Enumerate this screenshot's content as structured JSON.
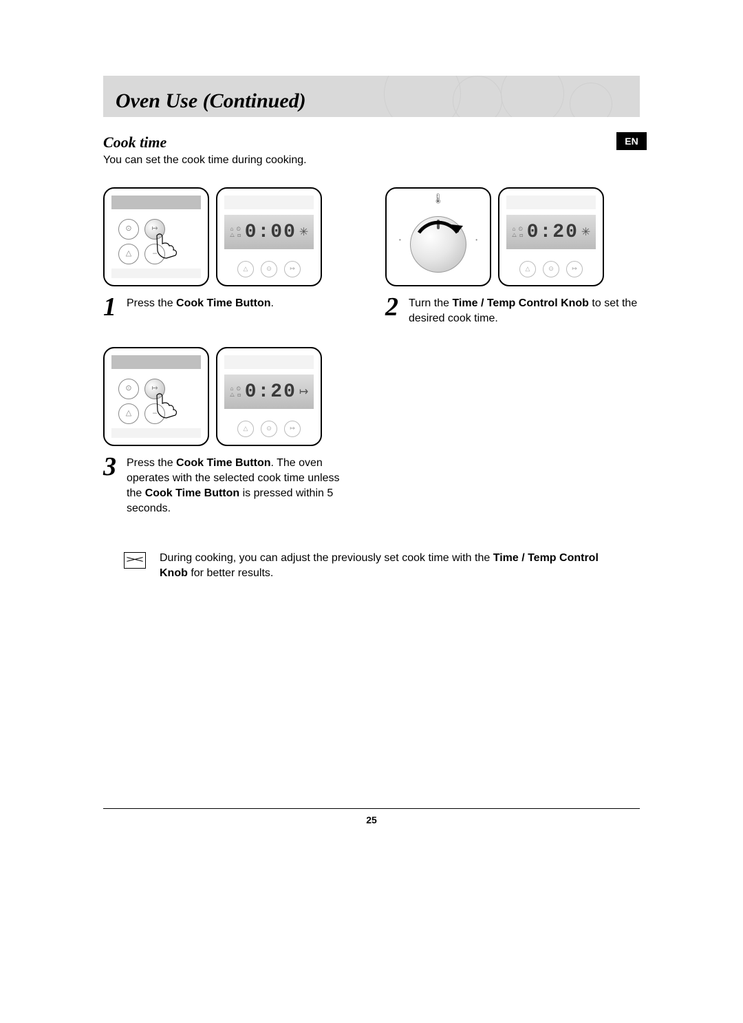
{
  "header": {
    "title": "Oven Use (Continued)"
  },
  "lang_badge": "EN",
  "section": {
    "heading": "Cook time",
    "intro": "You can set the cook time during cooking."
  },
  "steps": [
    {
      "num": "1",
      "display": "0:00",
      "text_pre": "Press the ",
      "bold": "Cook Time Button",
      "text_post": "."
    },
    {
      "num": "2",
      "display": "0:20",
      "text_pre": "Turn the ",
      "bold": "Time / Temp Control Knob",
      "text_post": " to set the desired cook time."
    },
    {
      "num": "3",
      "display": "0:20",
      "text_pre": "Press the ",
      "bold": "Cook Time Button",
      "text_mid": ". The oven operates with the selected cook time unless the ",
      "bold2": "Cook Time Button",
      "text_post": " is pressed within 5 seconds."
    }
  ],
  "note": {
    "pre": "During cooking, you can adjust the previously set cook time with the ",
    "bold": "Time / Temp Control Knob",
    "post": " for better results."
  },
  "page_number": "25",
  "glyphs": {
    "btn_time": "⊙",
    "btn_arrow": "↦",
    "btn_bell": "△",
    "btn_minus": "–",
    "seg_icons": "⌂ ⏲\n△ ⊡",
    "flash": "✳",
    "flash_small": "↦",
    "therm": "🌡",
    "dot": "•"
  }
}
